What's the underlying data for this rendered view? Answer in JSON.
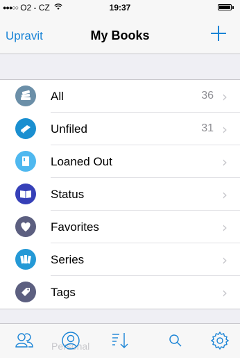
{
  "status_bar": {
    "signal": "●●●○○",
    "carrier": "O2 - CZ",
    "wifi_icon": "wifi-icon",
    "time": "19:37",
    "battery_level": 1.0
  },
  "nav": {
    "left_label": "Upravit",
    "title": "My Books",
    "add_icon": "plus-icon"
  },
  "list": [
    {
      "label": "All",
      "count": "36",
      "icon": "books-stack-icon",
      "color": "#6b8fa8"
    },
    {
      "label": "Unfiled",
      "count": "31",
      "icon": "book-icon",
      "color": "#1a8fd0"
    },
    {
      "label": "Loaned Out",
      "count": "",
      "icon": "loaned-book-icon",
      "color": "#4fb8ef"
    },
    {
      "label": "Status",
      "count": "",
      "icon": "open-book-icon",
      "color": "#3640b8"
    },
    {
      "label": "Favorites",
      "count": "",
      "icon": "heart-icon",
      "color": "#5c5f80"
    },
    {
      "label": "Series",
      "count": "",
      "icon": "series-books-icon",
      "color": "#2499d6"
    },
    {
      "label": "Tags",
      "count": "",
      "icon": "tag-icon",
      "color": "#5c5f80"
    }
  ],
  "tabbar": {
    "ghost_label": "Personal",
    "tabs": [
      "contacts-icon",
      "profile-icon",
      "sort-icon",
      "search-icon",
      "settings-icon"
    ],
    "accent": "#1a84d6"
  }
}
